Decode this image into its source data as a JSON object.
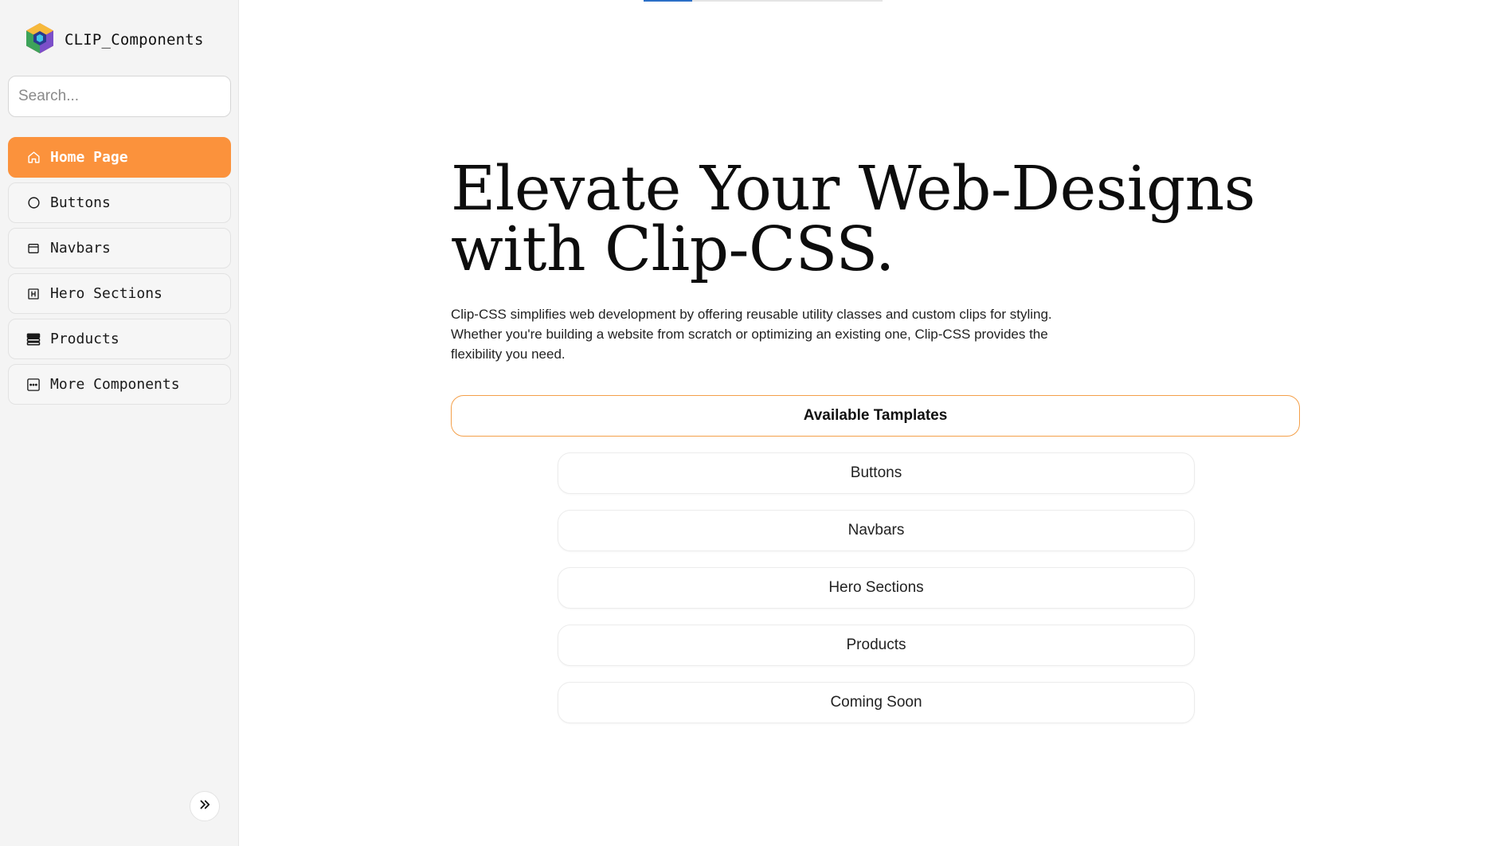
{
  "sidebar": {
    "brand": {
      "name": "CLIP_Components",
      "logo_icon": "hexagon-cube-logo"
    },
    "search": {
      "placeholder": "Search...",
      "value": ""
    },
    "items": [
      {
        "label": "Home Page",
        "icon": "home-icon",
        "active": true
      },
      {
        "label": "Buttons",
        "icon": "circle-icon",
        "active": false
      },
      {
        "label": "Navbars",
        "icon": "window-icon",
        "active": false
      },
      {
        "label": "Hero Sections",
        "icon": "hero-section-icon",
        "active": false
      },
      {
        "label": "Products",
        "icon": "stack-icon",
        "active": false
      },
      {
        "label": "More Components",
        "icon": "more-dots-icon",
        "active": false
      }
    ],
    "collapse_icon": "double-chevron-right-icon"
  },
  "main": {
    "hero": {
      "title_line1": "Elevate Your Web-Designs",
      "title_line2": "with Clip-CSS.",
      "description": "Clip-CSS simplifies web development by offering reusable utility classes and custom clips for styling. Whether you're building a website from scratch or optimizing an existing one, Clip-CSS provides the flexibility you need."
    },
    "templates": {
      "header": "Available Tamplates",
      "items": [
        "Buttons",
        "Navbars",
        "Hero Sections",
        "Products",
        "Coming Soon"
      ]
    }
  },
  "colors": {
    "accent": "#fb923c",
    "accent_border": "#f4a04a",
    "sidebar_bg": "#f4f4f4",
    "indicator": "#2b6fc7"
  }
}
